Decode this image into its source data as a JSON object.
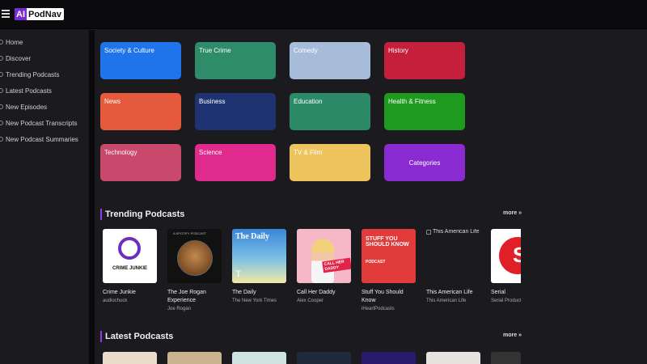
{
  "app": {
    "logo_ai": "AI",
    "logo_name": "PodNav"
  },
  "icons": {
    "menu": "hamburger-icon",
    "nav": "nav-item-icon",
    "more": "chevron-right-icon"
  },
  "sidebar": {
    "items": [
      {
        "label": "Home"
      },
      {
        "label": "Discover"
      },
      {
        "label": "Trending Podcasts"
      },
      {
        "label": "Latest Podcasts"
      },
      {
        "label": "New Episodes"
      },
      {
        "label": "New Podcast Transcripts"
      },
      {
        "label": "New Podcast Summaries"
      }
    ]
  },
  "categories": [
    {
      "label": "Society & Culture",
      "color": "#1f74ea"
    },
    {
      "label": "True Crime",
      "color": "#2e8c6a"
    },
    {
      "label": "Comedy",
      "color": "#a7bcd9"
    },
    {
      "label": "History",
      "color": "#c41f3b"
    },
    {
      "label": "News",
      "color": "#e55a3c"
    },
    {
      "label": "Business",
      "color": "#1f3372"
    },
    {
      "label": "Education",
      "color": "#2c8a69"
    },
    {
      "label": "Health & Fitness",
      "color": "#1e9a1e"
    },
    {
      "label": "Technology",
      "color": "#c8496c"
    },
    {
      "label": "Science",
      "color": "#e02a8d"
    },
    {
      "label": "TV & Film",
      "color": "#eec45f"
    },
    {
      "label": "Categories",
      "color": "#8a2ad1"
    }
  ],
  "trending": {
    "title": "Trending Podcasts",
    "more": "more »",
    "items": [
      {
        "title": "Crime Junkie",
        "author": "audiochuck",
        "cover_text": "CRIME JUNKIE"
      },
      {
        "title": "The Joe Rogan Experience",
        "author": "Joe Rogan",
        "cover_text": "A SPOTIFY PODCAST"
      },
      {
        "title": "The Daily",
        "author": "The New York Times",
        "cover_text": "The Daily",
        "cover_mark": "T"
      },
      {
        "title": "Call Her Daddy",
        "author": "Alex Cooper",
        "cover_text": "CALL HER DADDY"
      },
      {
        "title": "Stuff You Should Know",
        "author": "iHeartPodcasts",
        "cover_text": "STUFF YOU SHOULD KNOW",
        "cover_sub": "PODCAST"
      },
      {
        "title": "This American Life",
        "author": "This American Life",
        "cover_alt": "This American Life"
      },
      {
        "title": "Serial",
        "author": "Serial Productions",
        "cover_text": "S"
      }
    ]
  },
  "latest": {
    "title": "Latest Podcasts",
    "more": "more »",
    "thumb_colors": [
      "#e9dcc8",
      "#c9b28f",
      "#cfe3df",
      "#1f2b3a",
      "#2a1a6e",
      "#e8e2de",
      "#333333"
    ]
  }
}
